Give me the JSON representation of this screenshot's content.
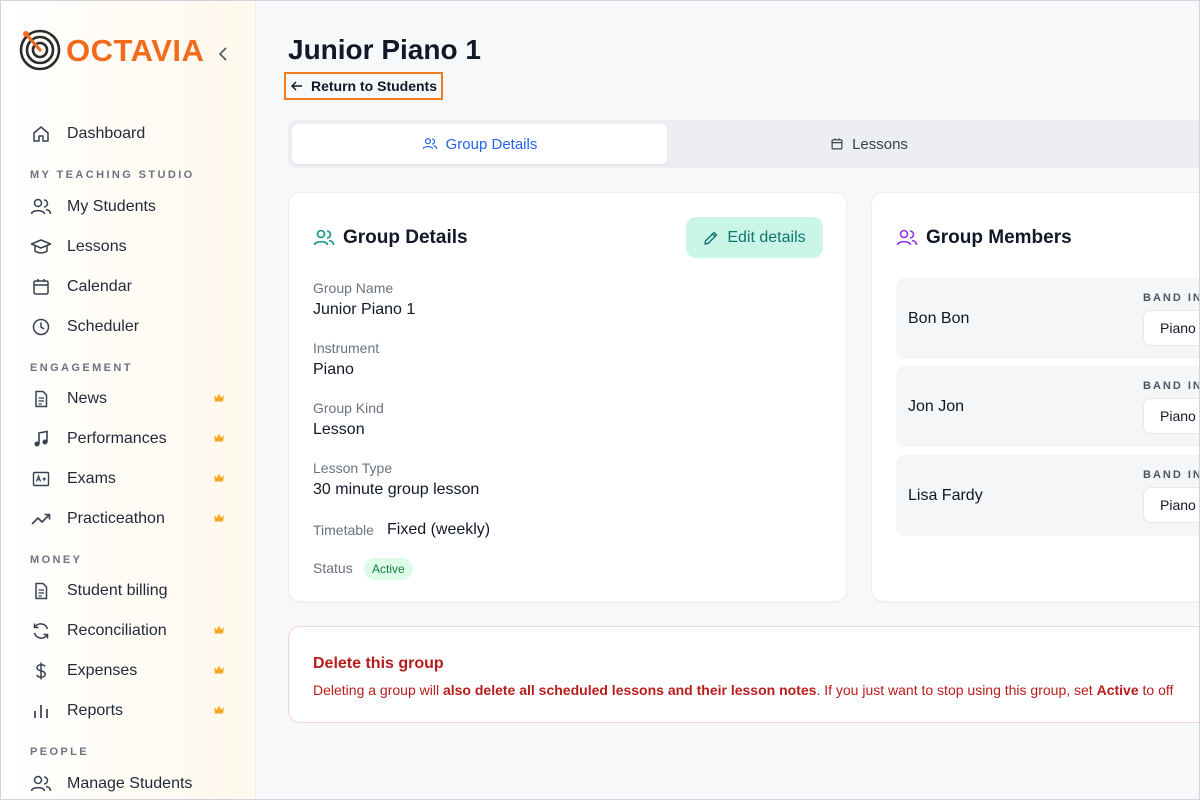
{
  "app": {
    "name": "OCTAVIA"
  },
  "sidebar": {
    "items": [
      {
        "label": "Dashboard",
        "icon": "home-icon"
      },
      {
        "label": "My Students",
        "icon": "users-icon"
      },
      {
        "label": "Lessons",
        "icon": "graduation-cap-icon"
      },
      {
        "label": "Calendar",
        "icon": "calendar-icon"
      },
      {
        "label": "Scheduler",
        "icon": "clock-icon"
      },
      {
        "label": "News",
        "icon": "document-icon",
        "premium": true
      },
      {
        "label": "Performances",
        "icon": "music-note-icon",
        "premium": true
      },
      {
        "label": "Exams",
        "icon": "grade-icon",
        "premium": true
      },
      {
        "label": "Practiceathon",
        "icon": "trending-up-icon",
        "premium": true
      },
      {
        "label": "Student billing",
        "icon": "receipt-icon"
      },
      {
        "label": "Reconciliation",
        "icon": "refresh-icon",
        "premium": true
      },
      {
        "label": "Expenses",
        "icon": "dollar-icon",
        "premium": true
      },
      {
        "label": "Reports",
        "icon": "bar-chart-icon",
        "premium": true
      },
      {
        "label": "Manage Students",
        "icon": "users-icon"
      }
    ],
    "sections": [
      "MY TEACHING STUDIO",
      "ENGAGEMENT",
      "MONEY",
      "PEOPLE"
    ]
  },
  "page": {
    "title": "Junior Piano 1",
    "back_label": "Return to Students"
  },
  "tabs": [
    {
      "label": "Group Details",
      "active": true
    },
    {
      "label": "Lessons",
      "active": false
    }
  ],
  "details": {
    "title": "Group Details",
    "edit_label": "Edit details",
    "group_name_label": "Group Name",
    "group_name": "Junior Piano 1",
    "instrument_label": "Instrument",
    "instrument": "Piano",
    "group_kind_label": "Group Kind",
    "group_kind": "Lesson",
    "lesson_type_label": "Lesson Type",
    "lesson_type": "30 minute group lesson",
    "timetable_label": "Timetable",
    "timetable": "Fixed (weekly)",
    "status_label": "Status",
    "status": "Active"
  },
  "members": {
    "title": "Group Members",
    "band_label": "BAND IN",
    "list": [
      {
        "name": "Bon Bon",
        "band": "Piano"
      },
      {
        "name": "Jon Jon",
        "band": "Piano"
      },
      {
        "name": "Lisa Fardy",
        "band": "Piano"
      }
    ]
  },
  "danger": {
    "title": "Delete this group",
    "text_1": "Deleting a group will ",
    "text_bold_1": "also delete all scheduled lessons and their lesson notes",
    "text_2": ". If you just want to stop using this group, set ",
    "text_bold_2": "Active",
    "text_3": " to off"
  },
  "colors": {
    "brand": "#f26b1d",
    "active_tab": "#2563eb",
    "premium": "#f5a623",
    "danger": "#b91c1c",
    "edit_bg": "#c9f6e6"
  }
}
